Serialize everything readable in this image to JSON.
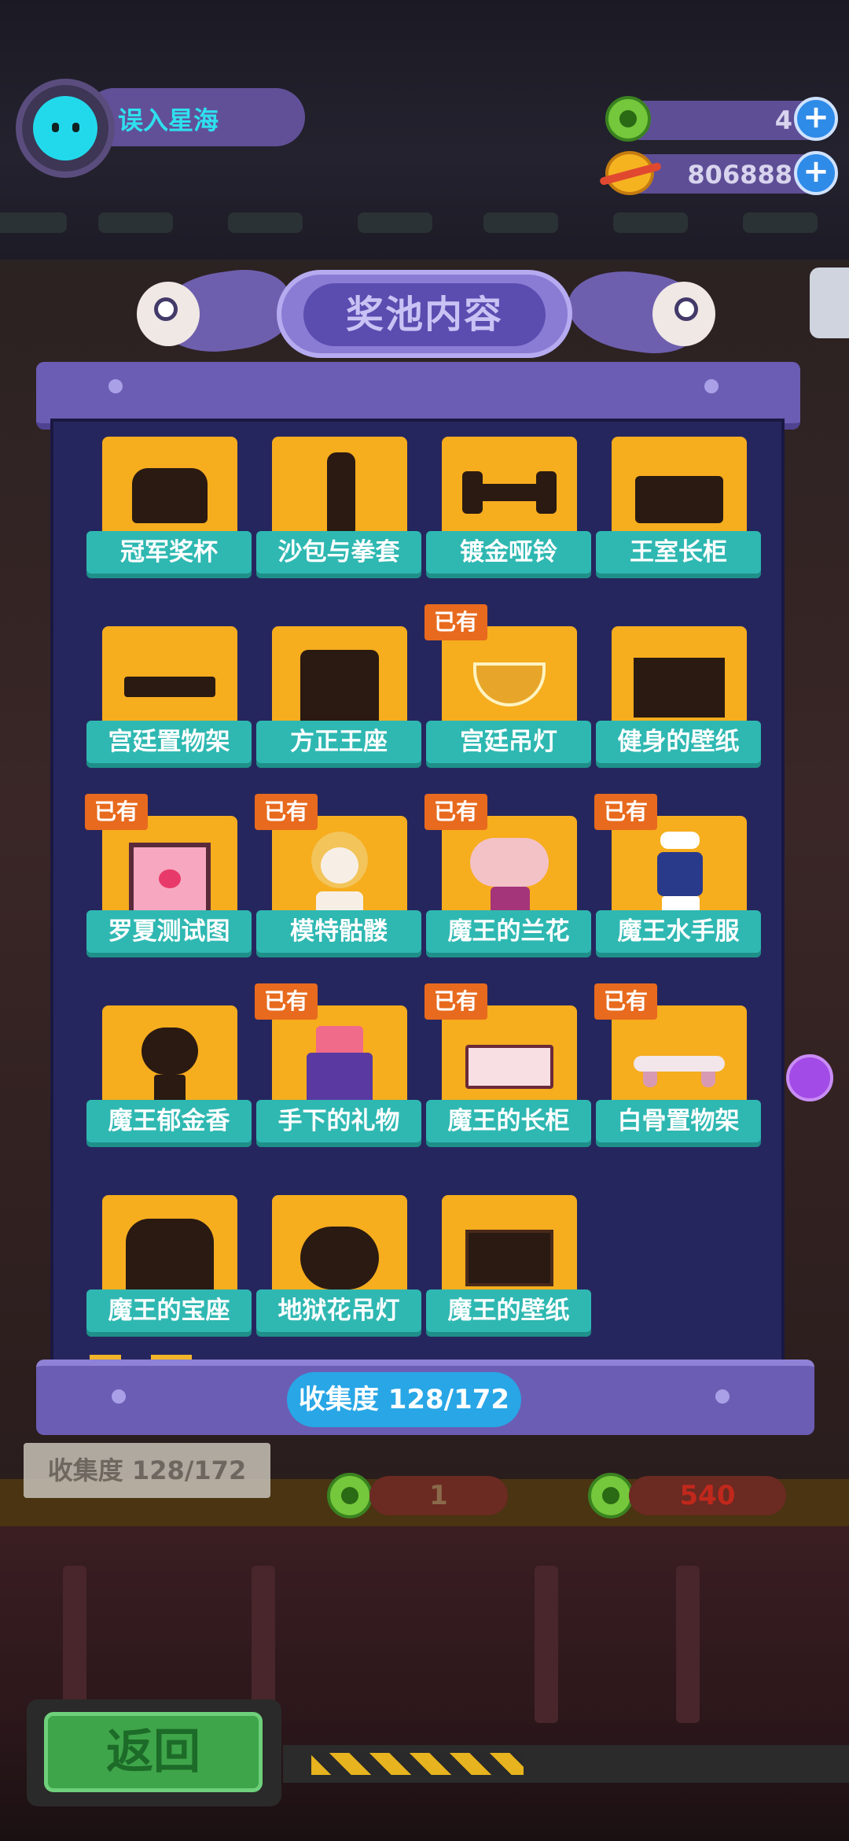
{
  "profile": {
    "name": "误入星海"
  },
  "currency": {
    "gems": {
      "value": "4",
      "icon": "green-donut-icon"
    },
    "coins": {
      "value": "806888",
      "icon": "planet-coin-icon"
    },
    "add_label": "+"
  },
  "banner": {
    "title": "奖池内容"
  },
  "owned_label": "已有",
  "items": [
    {
      "name": "冠军奖杯",
      "owned": false,
      "icon": "trophy-silhouette"
    },
    {
      "name": "沙包与拳套",
      "owned": false,
      "icon": "punching-bag-silhouette"
    },
    {
      "name": "镀金哑铃",
      "owned": false,
      "icon": "dumbbell-silhouette"
    },
    {
      "name": "王室长柜",
      "owned": false,
      "icon": "cabinet-silhouette"
    },
    {
      "name": "宫廷置物架",
      "owned": false,
      "icon": "shelf-silhouette"
    },
    {
      "name": "方正王座",
      "owned": false,
      "icon": "throne-silhouette"
    },
    {
      "name": "宫廷吊灯",
      "owned": true,
      "icon": "chandelier-icon"
    },
    {
      "name": "健身的壁纸",
      "owned": false,
      "icon": "wallpaper-silhouette"
    },
    {
      "name": "罗夏测试图",
      "owned": true,
      "icon": "heart-frame-icon"
    },
    {
      "name": "模特骷髅",
      "owned": true,
      "icon": "skeleton-doll-icon"
    },
    {
      "name": "魔王的兰花",
      "owned": true,
      "icon": "orchid-pot-icon"
    },
    {
      "name": "魔王水手服",
      "owned": true,
      "icon": "sailor-outfit-icon"
    },
    {
      "name": "魔王郁金香",
      "owned": false,
      "icon": "tulip-silhouette"
    },
    {
      "name": "手下的礼物",
      "owned": true,
      "icon": "gift-box-icon"
    },
    {
      "name": "魔王的长柜",
      "owned": true,
      "icon": "long-cabinet-icon"
    },
    {
      "name": "白骨置物架",
      "owned": true,
      "icon": "bone-shelf-icon"
    },
    {
      "name": "魔王的宝座",
      "owned": false,
      "icon": "demon-throne-silhouette"
    },
    {
      "name": "地狱花吊灯",
      "owned": false,
      "icon": "hell-chandelier-silhouette"
    },
    {
      "name": "魔王的壁纸",
      "owned": false,
      "icon": "demon-wallpaper-silhouette"
    }
  ],
  "collection": {
    "progress_text": "收集度 128/172"
  },
  "background": {
    "collection_text": "收集度 128/172",
    "cost_capsule": "1",
    "cost_gem": "540"
  },
  "back_button": {
    "label": "返回"
  },
  "colors": {
    "card": "#f6ad1e",
    "ribbon": "#2fb8b2",
    "owned_tag": "#e86a1e",
    "panel": "#26265e",
    "progress": "#28a6e6"
  }
}
